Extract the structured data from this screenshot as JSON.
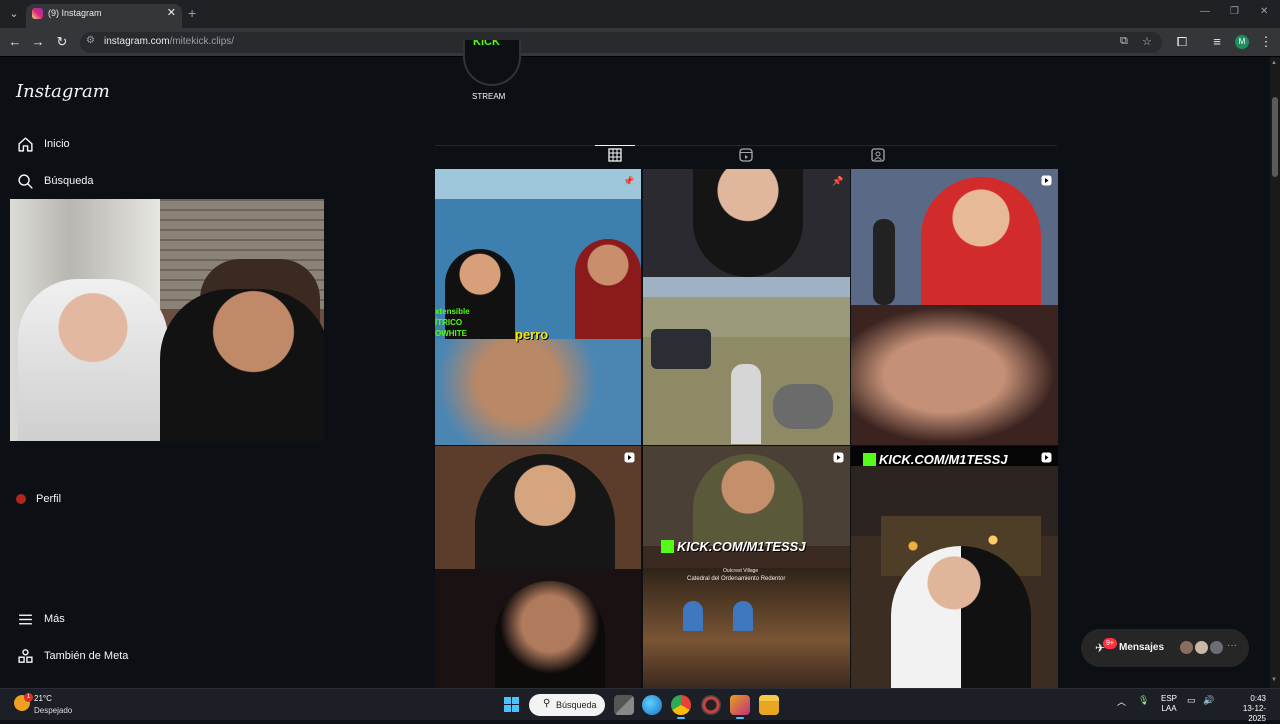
{
  "browser": {
    "tab_title": "(9) Instagram",
    "url_host": "instagram.com",
    "url_path": "/mitekick.clips/"
  },
  "sidebar": {
    "logo": "Instagram",
    "items": [
      {
        "label": "Inicio",
        "icon": "home-icon"
      },
      {
        "label": "Búsqueda",
        "icon": "search-icon"
      },
      {
        "label": "Perfil",
        "icon": "profile-icon"
      },
      {
        "label": "Más",
        "icon": "menu-icon"
      },
      {
        "label": "También de Meta",
        "icon": "meta-icon"
      }
    ]
  },
  "profile": {
    "highlight_label": "STREAM",
    "highlight_logo": "KICK",
    "tabs": [
      "posts-grid-icon",
      "reels-icon",
      "tagged-icon"
    ]
  },
  "grid": {
    "captions": {
      "post1_text": "perro",
      "post1_side": "xtensible\nÍTRICO\nOWHITE",
      "post8_banner": "KICK.COM/M1TESSJ",
      "post9_banner": "KICK.COM/M1TESSJ",
      "post8_location": "Outcrest Village",
      "post8_sublocation": "Catedral del Ordenamiento Redentor"
    }
  },
  "messages": {
    "label": "Mensajes",
    "count": "9+"
  },
  "taskbar": {
    "temperature": "21°C",
    "weather": "Despejado",
    "weather_badge": "1",
    "search_label": "Búsqueda",
    "lang_top": "ESP",
    "lang_bottom": "LAA",
    "time": "0:43",
    "date": "13-12-2025"
  },
  "colors": {
    "background": "#0c1014",
    "kick_green": "#53fc18",
    "badge_red": "#ff3040"
  }
}
